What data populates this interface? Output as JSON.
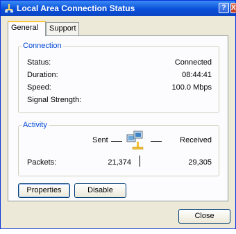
{
  "window": {
    "title": "Local Area Connection Status",
    "help_label": "?",
    "close_label": "X"
  },
  "tabs": [
    {
      "label": "General"
    },
    {
      "label": "Support"
    }
  ],
  "connection": {
    "legend": "Connection",
    "rows": [
      {
        "label": "Status:",
        "value": "Connected"
      },
      {
        "label": "Duration:",
        "value": "08:44:41"
      },
      {
        "label": "Speed:",
        "value": "100.0 Mbps"
      },
      {
        "label": "Signal Strength:",
        "value": ""
      }
    ]
  },
  "activity": {
    "legend": "Activity",
    "sent_label": "Sent",
    "received_label": "Received",
    "packets_label": "Packets:",
    "packets_sent": "21,374",
    "packets_received": "29,305"
  },
  "buttons": {
    "properties": "Properties",
    "disable": "Disable",
    "close": "Close"
  },
  "colors": {
    "titlebar": "#0a4fd8",
    "legend": "#0046d5",
    "dialog_bg": "#ece9d8",
    "tab_accent": "#ffc73c"
  },
  "icons": {
    "title": "network-connection-icon",
    "activity": "network-computers-icon"
  }
}
